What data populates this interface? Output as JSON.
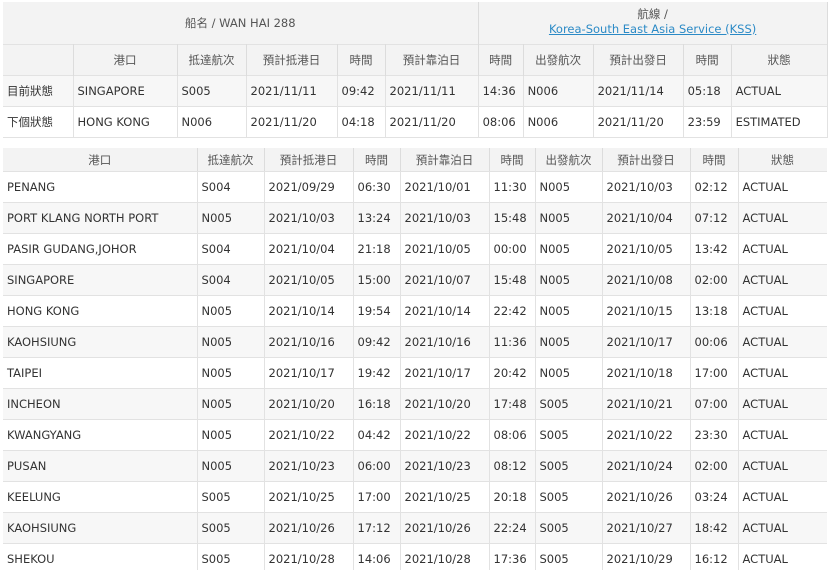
{
  "vessel": {
    "label": "船名 / WAN HAI 288"
  },
  "route": {
    "label": "航線 /",
    "link_text": "Korea-South East Asia Service (KSS)"
  },
  "status_table": {
    "headers": [
      "港口",
      "抵達航次",
      "預計抵港日",
      "時間",
      "預計靠泊日",
      "時間",
      "出發航次",
      "預計出發日",
      "時間",
      "狀態"
    ],
    "rows": [
      {
        "label": "目前狀態",
        "cells": [
          "SINGAPORE",
          "S005",
          "2021/11/11",
          "09:42",
          "2021/11/11",
          "14:36",
          "N006",
          "2021/11/14",
          "05:18",
          "ACTUAL"
        ]
      },
      {
        "label": "下個狀態",
        "cells": [
          "HONG KONG",
          "N006",
          "2021/11/20",
          "04:18",
          "2021/11/20",
          "08:06",
          "N006",
          "2021/11/20",
          "23:59",
          "ESTIMATED"
        ]
      }
    ]
  },
  "port_table": {
    "headers": [
      "港口",
      "抵達航次",
      "預計抵港日",
      "時間",
      "預計靠泊日",
      "時間",
      "出發航次",
      "預計出發日",
      "時間",
      "狀態"
    ],
    "rows": [
      [
        "PENANG",
        "S004",
        "2021/09/29",
        "06:30",
        "2021/10/01",
        "11:30",
        "N005",
        "2021/10/03",
        "02:12",
        "ACTUAL"
      ],
      [
        "PORT KLANG NORTH PORT",
        "N005",
        "2021/10/03",
        "13:24",
        "2021/10/03",
        "15:48",
        "N005",
        "2021/10/04",
        "07:12",
        "ACTUAL"
      ],
      [
        "PASIR GUDANG,JOHOR",
        "S004",
        "2021/10/04",
        "21:18",
        "2021/10/05",
        "00:00",
        "N005",
        "2021/10/05",
        "13:42",
        "ACTUAL"
      ],
      [
        "SINGAPORE",
        "S004",
        "2021/10/05",
        "15:00",
        "2021/10/07",
        "15:48",
        "N005",
        "2021/10/08",
        "02:00",
        "ACTUAL"
      ],
      [
        "HONG KONG",
        "N005",
        "2021/10/14",
        "19:54",
        "2021/10/14",
        "22:42",
        "N005",
        "2021/10/15",
        "13:18",
        "ACTUAL"
      ],
      [
        "KAOHSIUNG",
        "N005",
        "2021/10/16",
        "09:42",
        "2021/10/16",
        "11:36",
        "N005",
        "2021/10/17",
        "00:06",
        "ACTUAL"
      ],
      [
        "TAIPEI",
        "N005",
        "2021/10/17",
        "19:42",
        "2021/10/17",
        "20:42",
        "N005",
        "2021/10/18",
        "17:00",
        "ACTUAL"
      ],
      [
        "INCHEON",
        "N005",
        "2021/10/20",
        "16:18",
        "2021/10/20",
        "17:48",
        "S005",
        "2021/10/21",
        "07:00",
        "ACTUAL"
      ],
      [
        "KWANGYANG",
        "N005",
        "2021/10/22",
        "04:42",
        "2021/10/22",
        "08:06",
        "S005",
        "2021/10/22",
        "23:30",
        "ACTUAL"
      ],
      [
        "PUSAN",
        "N005",
        "2021/10/23",
        "06:00",
        "2021/10/23",
        "08:12",
        "S005",
        "2021/10/24",
        "02:00",
        "ACTUAL"
      ],
      [
        "KEELUNG",
        "S005",
        "2021/10/25",
        "17:00",
        "2021/10/25",
        "20:18",
        "S005",
        "2021/10/26",
        "03:24",
        "ACTUAL"
      ],
      [
        "KAOHSIUNG",
        "S005",
        "2021/10/26",
        "17:12",
        "2021/10/26",
        "22:24",
        "S005",
        "2021/10/27",
        "18:42",
        "ACTUAL"
      ],
      [
        "SHEKOU",
        "S005",
        "2021/10/28",
        "14:06",
        "2021/10/28",
        "17:36",
        "S005",
        "2021/10/29",
        "16:12",
        "ACTUAL"
      ]
    ]
  }
}
